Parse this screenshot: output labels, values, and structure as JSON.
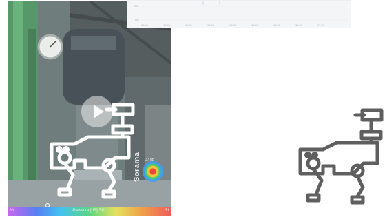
{
  "video": {
    "brand": "Sorama",
    "hotspot_label": "37 dB",
    "scale": {
      "min_label": "20",
      "title": "Pressure [dB] SPL",
      "max_label": "31",
      "gradient_colors": [
        "#d35cff",
        "#4b7bff",
        "#35c6ff",
        "#52e07d",
        "#f2ee52",
        "#ffa03a",
        "#ff4f4f"
      ]
    }
  },
  "chart": {
    "y_ticks": [
      "270",
      "130"
    ],
    "x_ticks": [
      "09:00",
      "10:00",
      "11:00",
      "12:00",
      "13:00",
      "14:00",
      "15:00",
      "16:00",
      "17:00"
    ]
  },
  "icons": {
    "play": "play-icon",
    "robot_overlay": "robot-dog-icon",
    "robot_side": "robot-dog-icon"
  },
  "colors": {
    "robot_overlay_stroke": "#ffffff",
    "robot_side_stroke": "#5f5f5f"
  }
}
